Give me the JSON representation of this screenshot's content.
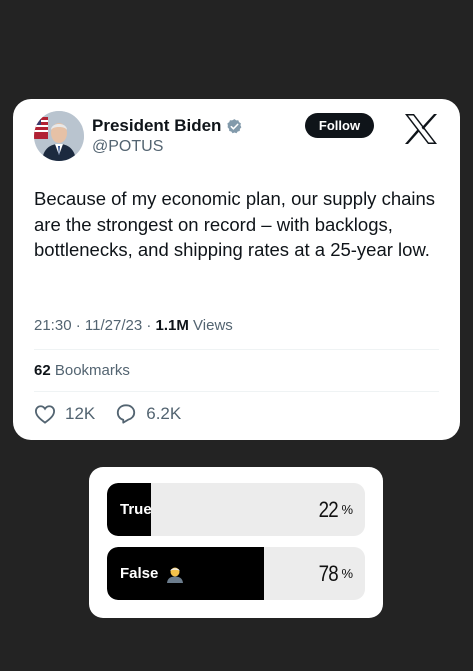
{
  "tweet": {
    "display_name": "President Biden",
    "handle": "@POTUS",
    "follow_label": "Follow",
    "text": "Because of my economic plan, our supply chains are the strongest on record – with backlogs, bottlenecks, and shipping rates at a 25-year low.",
    "time": "21:30",
    "date": "11/27/23",
    "views_count": "1.1M",
    "views_label": "Views",
    "bookmarks_count": "62",
    "bookmarks_label": "Bookmarks",
    "likes": "12K",
    "replies": "6.2K",
    "icons": {
      "verified": "verified-badge-icon",
      "brand": "x-logo-icon",
      "like": "heart-icon",
      "reply": "speech-bubble-icon"
    },
    "colors": {
      "text": "#0f1419",
      "muted": "#536471",
      "follow_bg": "#0f1419"
    }
  },
  "poll": {
    "options": [
      {
        "label": "True",
        "percent": 22,
        "percent_text": "22",
        "symbol": "%"
      },
      {
        "label": "False",
        "percent": 78,
        "percent_text": "78",
        "symbol": "%",
        "emoji": "person-emoji-icon"
      }
    ],
    "colors": {
      "fill": "#000000",
      "track": "#ececec"
    }
  },
  "background_color": "#232323"
}
